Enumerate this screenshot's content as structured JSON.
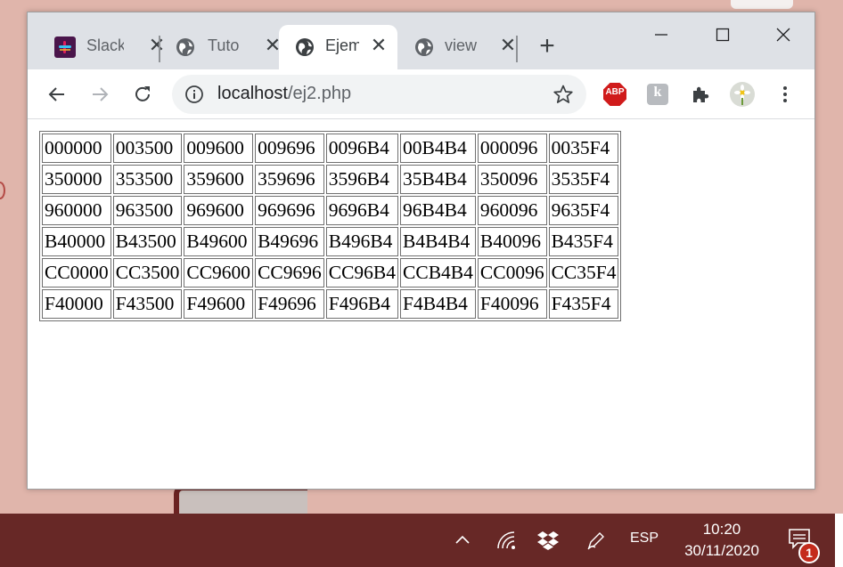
{
  "browser": {
    "tabs": [
      {
        "label": "Slack",
        "icon": "slack-icon",
        "active": false
      },
      {
        "label": "Tuto",
        "icon": "globe-icon",
        "active": false
      },
      {
        "label": "Ejem",
        "icon": "globe-icon",
        "active": true
      },
      {
        "label": "view",
        "icon": "globe-icon",
        "active": false
      }
    ],
    "new_tab": "+",
    "address": {
      "host": "localhost",
      "path": "/ej2.php"
    },
    "extensions": [
      "adblock-plus-icon",
      "reader-extension-icon",
      "extensions-puzzle-icon",
      "profile-avatar"
    ],
    "ext_labels": {
      "adblock": "ABP",
      "reader": "k"
    }
  },
  "table": [
    [
      "000000",
      "003500",
      "009600",
      "009696",
      "0096B4",
      "00B4B4",
      "000096",
      "0035F4"
    ],
    [
      "350000",
      "353500",
      "359600",
      "359696",
      "3596B4",
      "35B4B4",
      "350096",
      "3535F4"
    ],
    [
      "960000",
      "963500",
      "969600",
      "969696",
      "9696B4",
      "96B4B4",
      "960096",
      "9635F4"
    ],
    [
      "B40000",
      "B43500",
      "B49600",
      "B49696",
      "B496B4",
      "B4B4B4",
      "B40096",
      "B435F4"
    ],
    [
      "CC0000",
      "CC3500",
      "CC9600",
      "CC9696",
      "CC96B4",
      "CCB4B4",
      "CC0096",
      "CC35F4"
    ],
    [
      "F40000",
      "F43500",
      "F49600",
      "F49696",
      "F496B4",
      "F4B4B4",
      "F40096",
      "F435F4"
    ]
  ],
  "taskbar": {
    "language": "ESP",
    "time": "10:20",
    "date": "30/11/2020",
    "notification_count": "1"
  },
  "colors": {
    "taskbar": "#672826",
    "desktop": "#e0b5ab",
    "slack": "#4a154b",
    "abp": "#d01b1b"
  }
}
